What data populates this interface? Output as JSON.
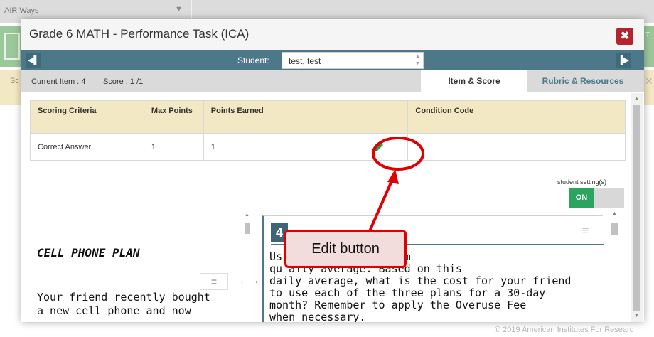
{
  "background": {
    "app_title": "AIR Ways",
    "sc_fragment": "Sc",
    "t_fragment": "T",
    "footer": "© 2019 American Institutes For Researc"
  },
  "modal": {
    "title": "Grade 6 MATH - Performance Task (ICA)",
    "close_label": "✖",
    "nav": {
      "prev_label": "◀▌",
      "next_label": "▐▶",
      "student_label": "Student:",
      "student_value": "test, test"
    },
    "info": {
      "current_item": "Current Item : 4",
      "score": "Score : 1 /1"
    },
    "tabs": [
      {
        "label": "Item & Score",
        "selected": true
      },
      {
        "label": "Rubric & Resources",
        "selected": false
      }
    ],
    "table": {
      "headers": [
        "Scoring Criteria",
        "Max Points",
        "Points Earned",
        "Condition Code"
      ],
      "rows": [
        [
          "Correct Answer",
          "1",
          "1",
          ""
        ]
      ]
    },
    "student_setting": {
      "label": "student setting(s)",
      "toggle_on_label": "ON"
    },
    "stimulus": {
      "title": "CELL PHONE PLAN",
      "text_line1": "Your friend recently bought",
      "text_line2": "a new cell phone and now"
    },
    "item": {
      "number": "4",
      "lines": [
        "Us         ber of minutes from",
        "qu           aily average. Based on this",
        "daily average, what is the cost for your friend",
        "to use each of the three plans for a 30-day",
        "month? Remember to apply the Overuse Fee",
        "when necessary."
      ]
    }
  },
  "annotation": {
    "callout_text": "Edit button",
    "color": "#e00000"
  },
  "colors": {
    "teal": "#4d7889",
    "close_red": "#b3242e",
    "toggle_green": "#2aa45e",
    "header_tan": "#f3e8c4"
  }
}
